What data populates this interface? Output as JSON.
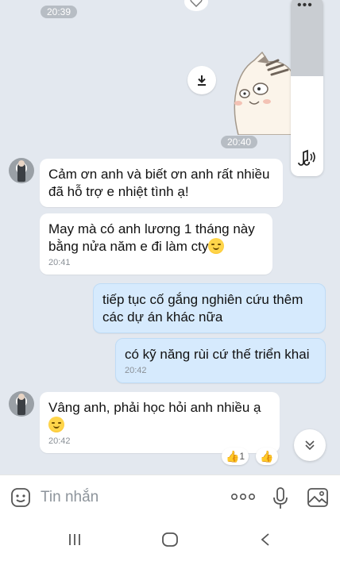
{
  "chat": {
    "timestamps": {
      "top": "20:39",
      "sticker": "20:40"
    },
    "messages": [
      {
        "side": "in",
        "text": "Cảm ơn anh và biết ơn anh rất nhiều đã hỗ trợ e nhiệt tình ạ!",
        "time": ""
      },
      {
        "side": "in",
        "text": "May mà có anh lương 1 tháng này bằng nửa năm e đi làm cty",
        "time": "20:41"
      },
      {
        "side": "out",
        "text": "tiếp tục cố gắng nghiên cứu thêm các dự án khác nữa",
        "time": ""
      },
      {
        "side": "out",
        "text": "có kỹ năng rùi cứ thế triển khai",
        "time": "20:42"
      },
      {
        "side": "in",
        "text": "Vâng anh, phải học hỏi anh nhiều ạ",
        "time": "20:42"
      }
    ],
    "reaction": {
      "icon": "thumbs-up-icon",
      "count": "1"
    }
  },
  "composer": {
    "placeholder": "Tin nhắn"
  },
  "colors": {
    "chat_bg": "#e3e8ef",
    "out_bubble": "#d6eafd",
    "in_bubble": "#ffffff"
  }
}
